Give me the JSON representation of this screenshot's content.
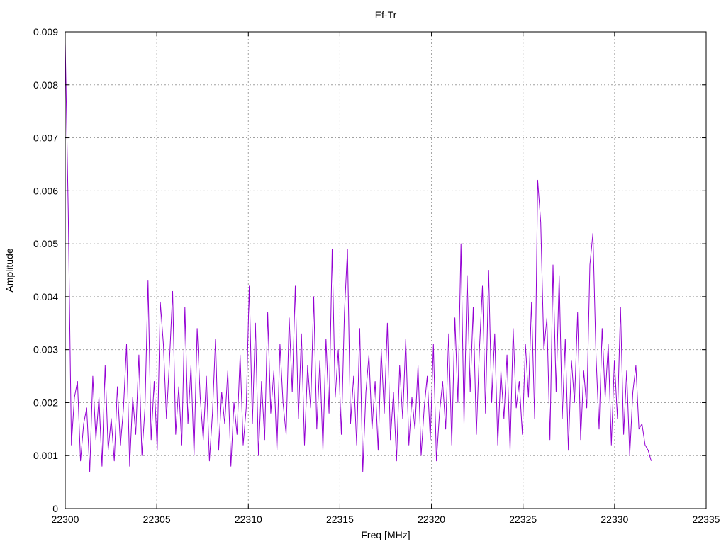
{
  "chart_data": {
    "type": "line",
    "title": "Ef-Tr",
    "xlabel": "Freq [MHz]",
    "ylabel": "Amplitude",
    "xlim": [
      22300,
      22335
    ],
    "ylim": [
      0,
      0.009
    ],
    "x_ticks": [
      "22300",
      "22305",
      "22310",
      "22315",
      "22320",
      "22325",
      "22330",
      "22335"
    ],
    "y_ticks": [
      "0",
      "0.001",
      "0.002",
      "0.003",
      "0.004",
      "0.005",
      "0.006",
      "0.007",
      "0.008",
      "0.009"
    ],
    "grid": true,
    "legend": "none",
    "series": [
      {
        "color": "#9400d3",
        "x_range": [
          22300,
          22332
        ],
        "values": [
          0.0088,
          0.0056,
          0.0012,
          0.0021,
          0.0024,
          0.0009,
          0.0016,
          0.0019,
          0.0007,
          0.0025,
          0.0013,
          0.0021,
          0.0008,
          0.0027,
          0.0011,
          0.0017,
          0.0009,
          0.0023,
          0.0012,
          0.0019,
          0.0031,
          0.0008,
          0.0021,
          0.0014,
          0.0029,
          0.001,
          0.0019,
          0.0043,
          0.0013,
          0.0024,
          0.0011,
          0.0039,
          0.0031,
          0.0017,
          0.0028,
          0.0041,
          0.0014,
          0.0023,
          0.0012,
          0.0038,
          0.0016,
          0.0027,
          0.001,
          0.0034,
          0.0021,
          0.0013,
          0.0025,
          0.0009,
          0.0018,
          0.0032,
          0.0011,
          0.0022,
          0.0016,
          0.0026,
          0.0008,
          0.002,
          0.0014,
          0.0029,
          0.0012,
          0.0019,
          0.0042,
          0.0016,
          0.0035,
          0.001,
          0.0024,
          0.0013,
          0.0037,
          0.0018,
          0.0026,
          0.0011,
          0.0031,
          0.002,
          0.0014,
          0.0036,
          0.0022,
          0.0042,
          0.0017,
          0.0033,
          0.0012,
          0.0027,
          0.0019,
          0.004,
          0.0015,
          0.0028,
          0.0011,
          0.0032,
          0.0018,
          0.0049,
          0.0021,
          0.003,
          0.0014,
          0.0037,
          0.0049,
          0.0016,
          0.0025,
          0.0012,
          0.0034,
          0.0007,
          0.0022,
          0.0029,
          0.0015,
          0.0024,
          0.0011,
          0.003,
          0.0018,
          0.0035,
          0.0013,
          0.0022,
          0.0009,
          0.0027,
          0.0017,
          0.0032,
          0.0012,
          0.0021,
          0.0015,
          0.0027,
          0.001,
          0.0019,
          0.0025,
          0.0013,
          0.0031,
          0.0009,
          0.0018,
          0.0024,
          0.0015,
          0.0033,
          0.0012,
          0.0036,
          0.002,
          0.005,
          0.0016,
          0.0044,
          0.0022,
          0.0038,
          0.0014,
          0.003,
          0.0042,
          0.0018,
          0.0045,
          0.002,
          0.0033,
          0.0012,
          0.0026,
          0.0017,
          0.0029,
          0.0011,
          0.0034,
          0.0019,
          0.0024,
          0.0014,
          0.0031,
          0.0021,
          0.0039,
          0.0017,
          0.0062,
          0.0054,
          0.003,
          0.0036,
          0.0013,
          0.0046,
          0.0022,
          0.0044,
          0.0017,
          0.0032,
          0.0011,
          0.0028,
          0.002,
          0.0037,
          0.0013,
          0.0026,
          0.0019,
          0.0046,
          0.0052,
          0.0029,
          0.0015,
          0.0034,
          0.0021,
          0.0031,
          0.0012,
          0.0028,
          0.0017,
          0.0038,
          0.0014,
          0.0026,
          0.001,
          0.0022,
          0.0027,
          0.0015,
          0.0016,
          0.0012,
          0.0011,
          0.0009
        ]
      }
    ]
  }
}
